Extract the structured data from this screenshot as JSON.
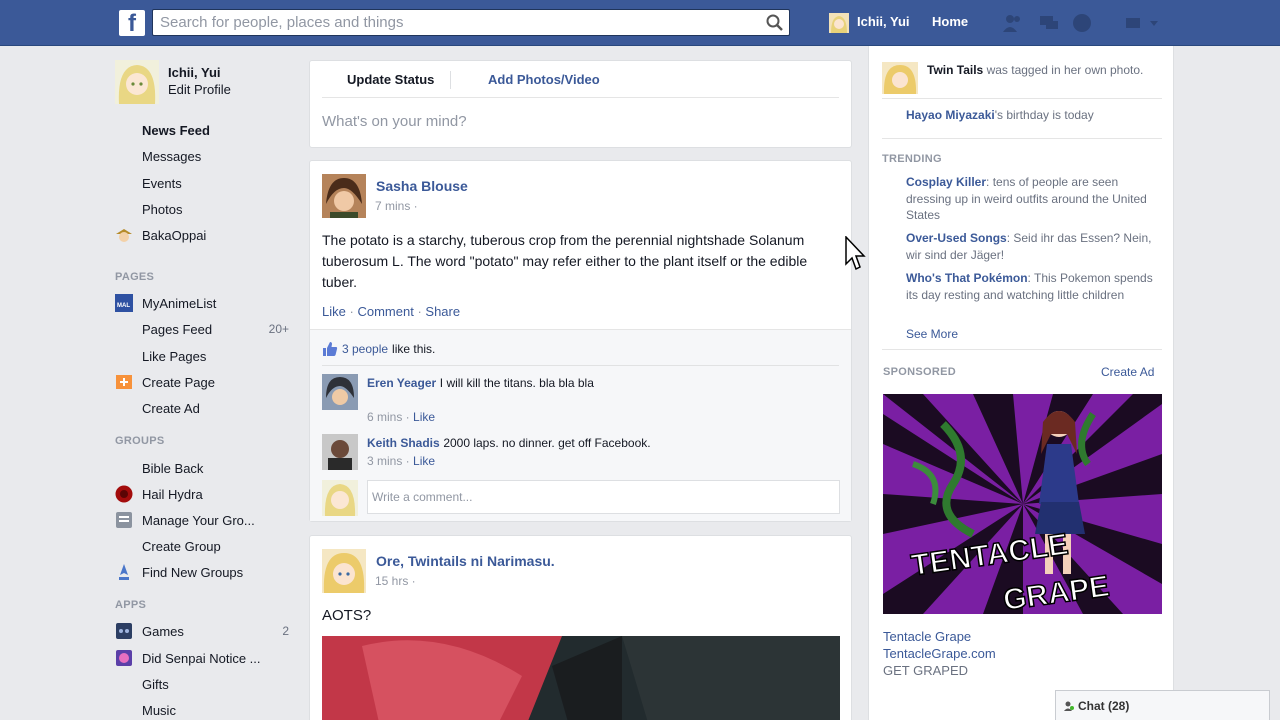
{
  "topbar": {
    "logo": "f",
    "search_placeholder": "Search for people, places and things",
    "user_name": "Ichii, Yui",
    "home_label": "Home",
    "icons": [
      "friends-icon",
      "messages-icon",
      "notifications-icon",
      "settings-icon"
    ]
  },
  "sidebar": {
    "profile_name": "Ichii, Yui",
    "edit_profile": "Edit Profile",
    "favorites": [
      {
        "label": "News Feed",
        "icon": "news-feed-icon"
      },
      {
        "label": "Messages",
        "icon": "messages-icon"
      },
      {
        "label": "Events",
        "icon": "events-icon"
      },
      {
        "label": "Photos",
        "icon": "photos-icon"
      },
      {
        "label": "BakaOppai",
        "icon": "app-icon"
      }
    ],
    "pages_heading": "PAGES",
    "pages": [
      {
        "label": "MyAnimeList",
        "icon": "mal-icon"
      },
      {
        "label": "Pages Feed",
        "count": "20+",
        "icon": "pages-feed-icon"
      },
      {
        "label": "Like Pages",
        "icon": "like-pages-icon"
      },
      {
        "label": "Create Page",
        "icon": "create-page-icon"
      },
      {
        "label": "Create Ad",
        "icon": "create-ad-icon"
      }
    ],
    "groups_heading": "GROUPS",
    "groups": [
      {
        "label": "Bible Back",
        "icon": "group-icon"
      },
      {
        "label": "Hail Hydra",
        "icon": "hydra-icon"
      },
      {
        "label": "Manage Your Gro...",
        "icon": "manage-groups-icon"
      },
      {
        "label": "Create Group",
        "icon": "create-group-icon"
      },
      {
        "label": "Find New Groups",
        "icon": "find-groups-icon"
      }
    ],
    "apps_heading": "APPS",
    "apps": [
      {
        "label": "Games",
        "count": "2",
        "icon": "games-icon"
      },
      {
        "label": "Did Senpai Notice ...",
        "icon": "app-icon"
      },
      {
        "label": "Gifts",
        "icon": "gifts-icon"
      },
      {
        "label": "Music",
        "icon": "music-icon"
      }
    ]
  },
  "composer": {
    "update_status": "Update Status",
    "add_photos": "Add Photos/Video",
    "placeholder": "What's on your mind?"
  },
  "post1": {
    "author": "Sasha Blouse",
    "time": "7 mins ·",
    "text": "The potato is a starchy, tuberous crop from the perennial nightshade Solanum tuberosum L. The word \"potato\" may refer either to the plant itself or the edible tuber.",
    "actions": {
      "like": "Like",
      "comment": "Comment",
      "share": "Share",
      "dot": "·"
    },
    "likes_count": "3 people",
    "likes_suffix": "like this.",
    "comments": [
      {
        "name": "Eren Yeager",
        "text": "I will kill the titans. bla bla bla",
        "time": "6 mins ·",
        "like": "Like"
      },
      {
        "name": "Keith Shadis",
        "text": "2000 laps. no dinner. get off Facebook.",
        "time": "3 mins ·",
        "like": "Like"
      }
    ],
    "write_placeholder": "Write a comment..."
  },
  "post2": {
    "author": "Ore, Twintails ni Narimasu.",
    "time": "15 hrs ·",
    "text": "AOTS?"
  },
  "right": {
    "ticker": [
      {
        "name": "Twin Tails",
        "rest": "was tagged in her own photo."
      },
      {
        "name": "Hayao Miyazaki",
        "rest": "'s birthday is today"
      }
    ],
    "trending_heading": "TRENDING",
    "trending": [
      {
        "topic": "Cosplay Killer",
        "desc": ": tens of people are seen dressing up in weird outfits around the United States"
      },
      {
        "topic": "Over-Used Songs",
        "desc": ": Seid ihr das Essen? Nein, wir sind der Jäger!"
      },
      {
        "topic": "Who's That Pokémon",
        "desc": ": This Pokemon spends its day resting and watching little children"
      }
    ],
    "see_more": "See More",
    "sponsored_heading": "SPONSORED",
    "create_ad": "Create Ad",
    "ad": {
      "title": "Tentacle Grape",
      "url": "TentacleGrape.com",
      "tagline": "GET GRAPED",
      "logo_line1": "TENTACLE",
      "logo_line2": "GRAPE"
    }
  },
  "chat": {
    "label": "Chat (28)"
  },
  "colors": {
    "brand": "#3b5998",
    "background": "#e9eaed",
    "ad_purple": "#7a1fa3"
  }
}
